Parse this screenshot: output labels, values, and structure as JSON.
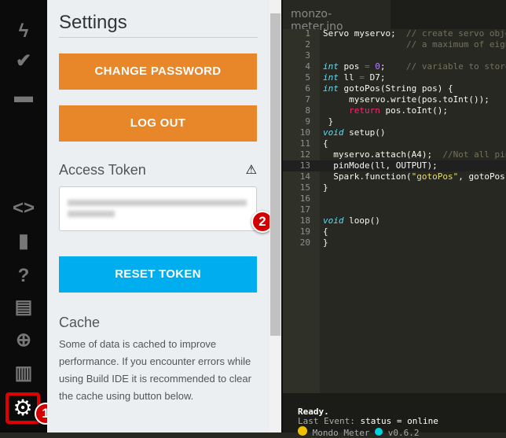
{
  "sidebar": {
    "items": [
      "flash-icon",
      "verify-icon",
      "folder-icon",
      "code-icon",
      "bookmark-icon",
      "help-icon",
      "docs-icon",
      "target-icon",
      "chart-icon",
      "gear-icon"
    ],
    "badge": "1"
  },
  "settings": {
    "title": "Settings",
    "change_password": "CHANGE PASSWORD",
    "log_out": "LOG OUT",
    "access_token_label": "Access Token",
    "warning_icon": "⚠",
    "reset_token": "RESET TOKEN",
    "badge": "2",
    "cache_label": "Cache",
    "cache_text": "Some of data is cached to improve performance. If you encounter errors while using Build IDE it is recommended to clear the cache using button below."
  },
  "editor": {
    "tab": "monzo-meter.ino"
  },
  "console": {
    "ready": "Ready.",
    "event_label": "Last Event:",
    "event": "status = online",
    "device": "Mondo Meter",
    "version": "v0.6.2"
  }
}
